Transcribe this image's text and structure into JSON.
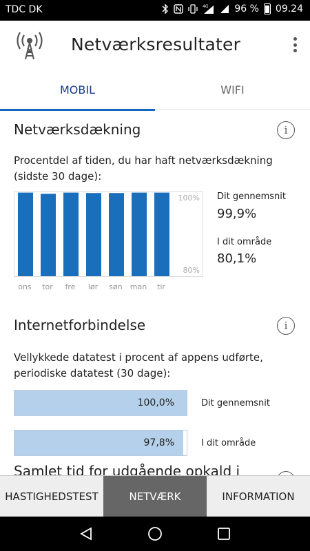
{
  "status_bar": {
    "carrier": "TDC DK",
    "battery": "96 %",
    "time": "09.24",
    "icons": [
      "bluetooth-icon",
      "nfc-icon",
      "vibrate-icon",
      "signal-4g-icon",
      "signal-bars-icon",
      "battery-icon"
    ]
  },
  "app_bar": {
    "title": "Netværksresultater",
    "logo_icon": "antenna-icon",
    "menu_icon": "more-vertical-icon"
  },
  "tabs": [
    {
      "label": "MOBIL",
      "active": true
    },
    {
      "label": "WIFI",
      "active": false
    }
  ],
  "coverage": {
    "title": "Netværksdækning",
    "description": "Procentdel af tiden, du har haft netværksdækning (sidste 30 dage):",
    "axis_top": "100%",
    "axis_bottom": "80%",
    "avg_label": "Dit gennemsnit",
    "avg_value": "99,9%",
    "area_label": "I dit område",
    "area_value": "80,1%"
  },
  "chart_data": {
    "type": "bar",
    "categories": [
      "ons",
      "tor",
      "fre",
      "lør",
      "søn",
      "man",
      "tir"
    ],
    "values": [
      99.9,
      99.6,
      99.9,
      99.8,
      99.8,
      99.9,
      99.9
    ],
    "ylim": [
      80,
      100
    ],
    "color": "#1a6fbd"
  },
  "internet": {
    "title": "Internetforbindelse",
    "description": "Vellykkede datatest i procent af appens udførte, periodiske datatest (30 dage):",
    "bars": [
      {
        "value_text": "100,0%",
        "fraction": 1.0,
        "label": "Dit gennemsnit"
      },
      {
        "value_text": "97,8%",
        "fraction": 0.978,
        "label": "I dit område"
      }
    ]
  },
  "calls": {
    "title": "Samlet tid for udgående opkald i"
  },
  "bottom_nav": [
    {
      "label": "HASTIGHEDSTEST",
      "active": false
    },
    {
      "label": "NETVÆRK",
      "active": true
    },
    {
      "label": "INFORMATION",
      "active": false
    }
  ],
  "colors": {
    "accent": "#1565c0",
    "bar": "#1a6fbd",
    "progress_fill": "#b5d0ea",
    "nav_active": "#666666"
  }
}
